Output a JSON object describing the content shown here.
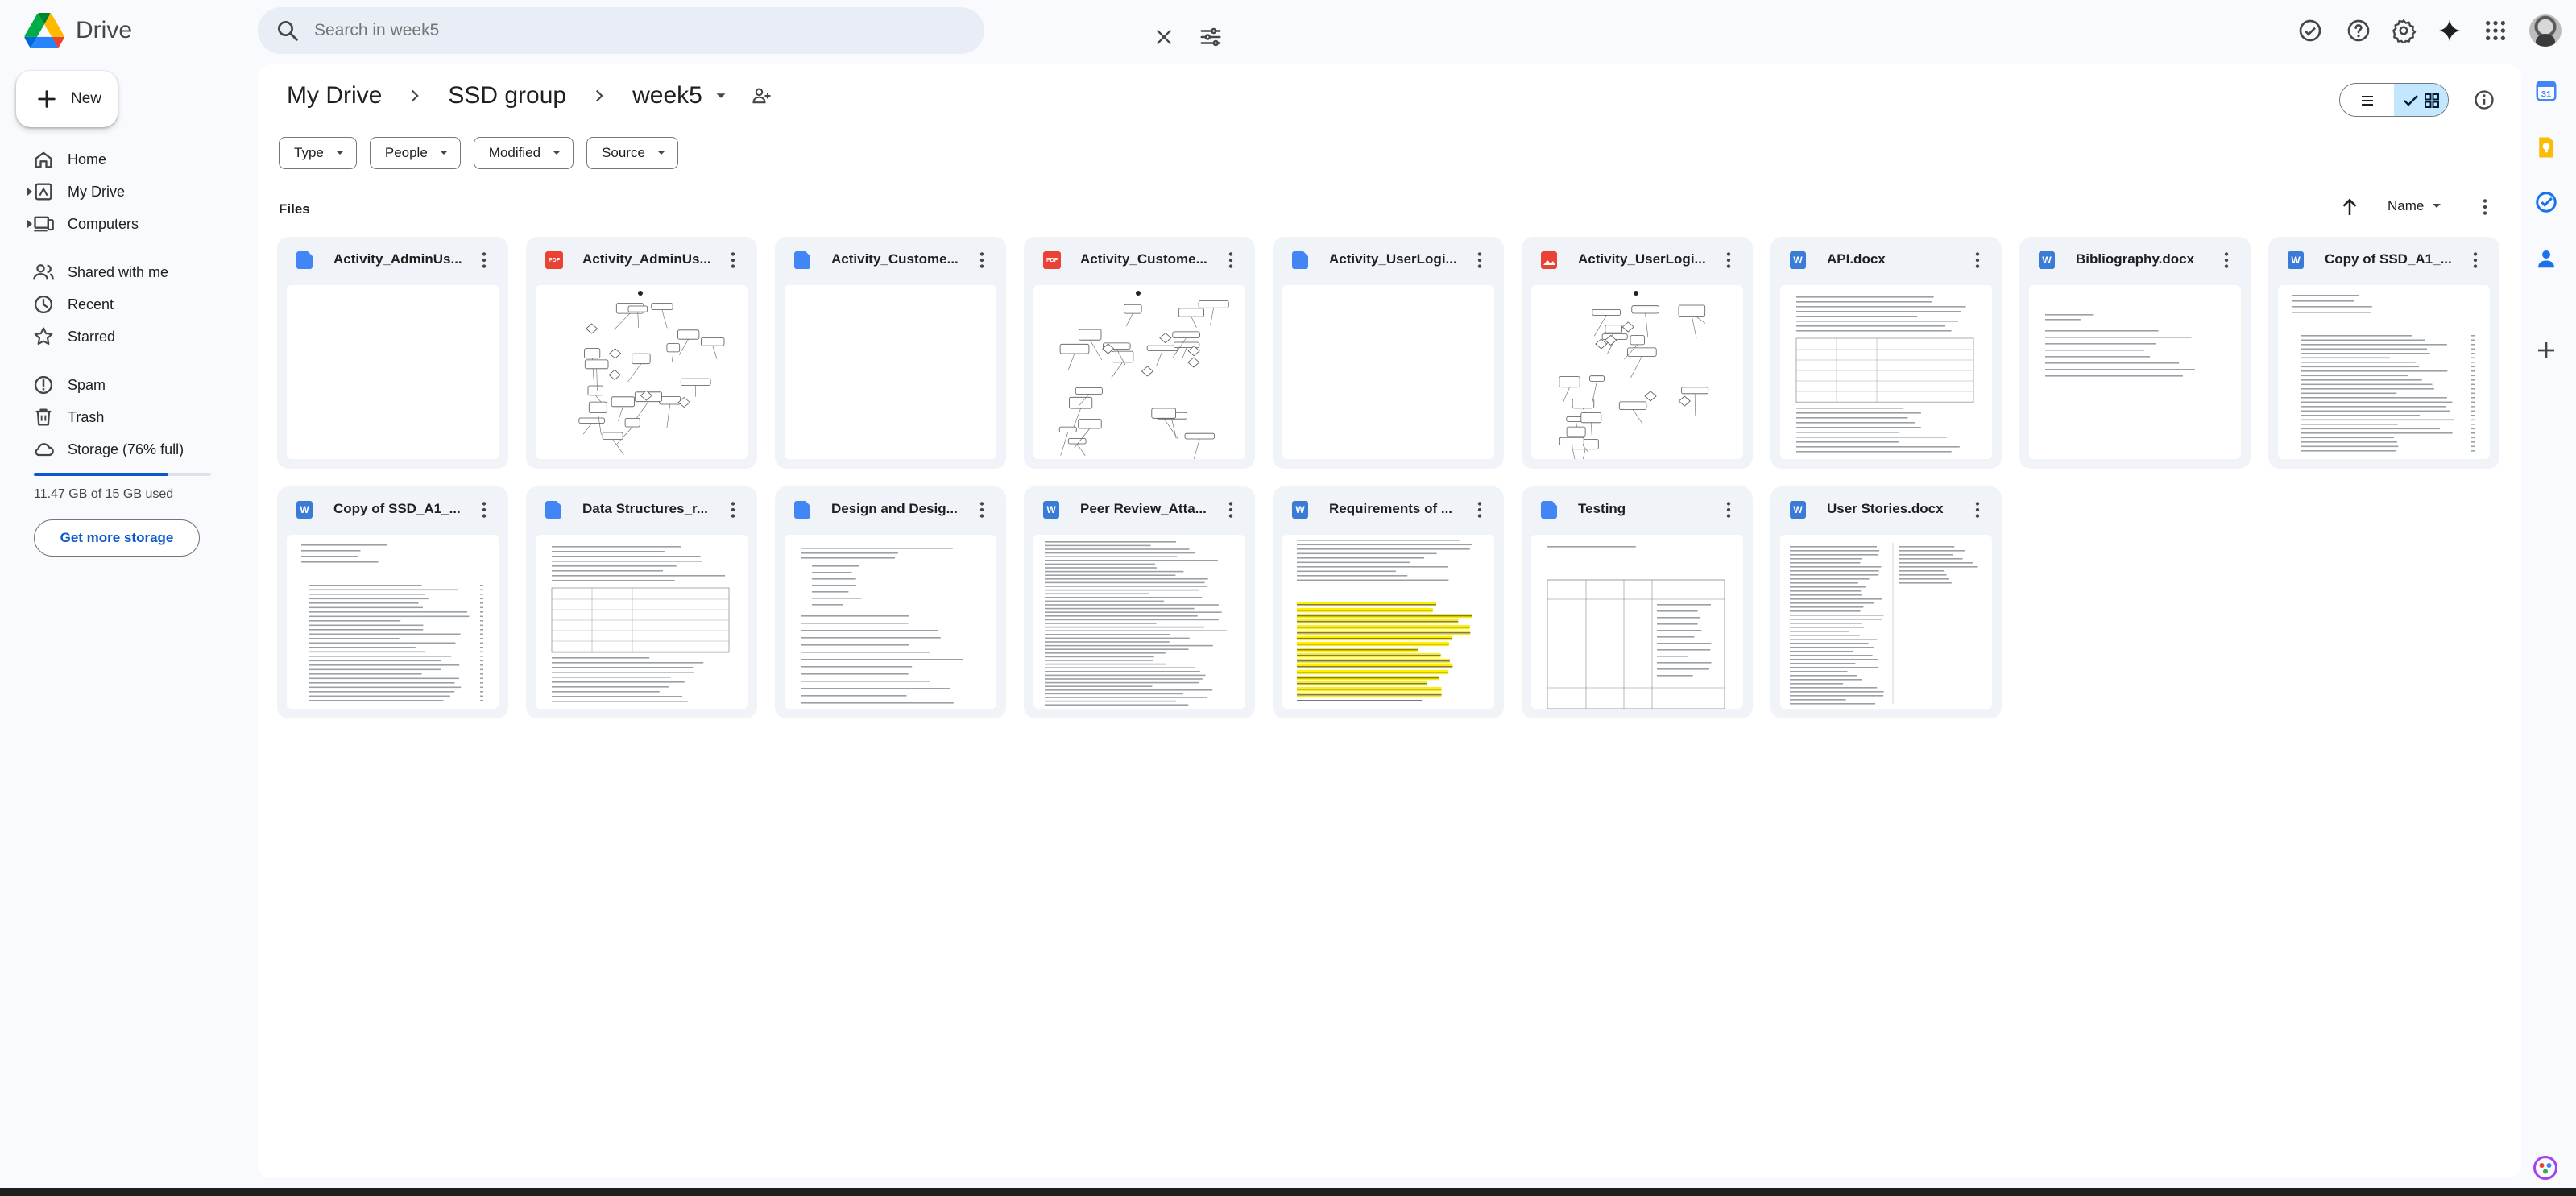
{
  "app": {
    "name": "Drive"
  },
  "search": {
    "placeholder": "Search in week5",
    "value": ""
  },
  "header_icons": [
    "offline-status-icon",
    "help-icon",
    "settings-icon",
    "gemini-icon",
    "apps-icon",
    "account-avatar"
  ],
  "sidebar": {
    "new_label": "New",
    "items": [
      {
        "label": "Home",
        "icon": "home-icon"
      },
      {
        "label": "My Drive",
        "icon": "my-drive-icon"
      },
      {
        "label": "Computers",
        "icon": "computers-icon"
      },
      {
        "label": "Shared with me",
        "icon": "shared-icon"
      },
      {
        "label": "Recent",
        "icon": "recent-icon"
      },
      {
        "label": "Starred",
        "icon": "star-icon"
      },
      {
        "label": "Spam",
        "icon": "spam-icon"
      },
      {
        "label": "Trash",
        "icon": "trash-icon"
      },
      {
        "label": "Storage (76% full)",
        "icon": "cloud-icon"
      }
    ],
    "storage_used_fraction": 0.76,
    "storage_text": "11.47 GB of 15 GB used",
    "get_more_storage": "Get more storage"
  },
  "breadcrumb": [
    "My Drive",
    "SSD group",
    "week5"
  ],
  "filters": [
    "Type",
    "People",
    "Modified",
    "Source"
  ],
  "section": {
    "title": "Files",
    "sort_label": "Name"
  },
  "files": [
    {
      "name": "Activity_AdminUs...",
      "type": "docs",
      "preview": "blank"
    },
    {
      "name": "Activity_AdminUs...",
      "type": "pdf",
      "preview": "flowchart"
    },
    {
      "name": "Activity_Custome...",
      "type": "docs",
      "preview": "blank"
    },
    {
      "name": "Activity_Custome...",
      "type": "pdf",
      "preview": "flowchart"
    },
    {
      "name": "Activity_UserLogi...",
      "type": "docs",
      "preview": "blank"
    },
    {
      "name": "Activity_UserLogi...",
      "type": "image",
      "preview": "flowchart"
    },
    {
      "name": "API.docx",
      "type": "word",
      "preview": "doc-table"
    },
    {
      "name": "Bibliography.docx",
      "type": "word",
      "preview": "doc-sparse"
    },
    {
      "name": "Copy of SSD_A1_...",
      "type": "word",
      "preview": "doc-toc"
    },
    {
      "name": "Copy of SSD_A1_...",
      "type": "word",
      "preview": "doc-toc"
    },
    {
      "name": "Data Structures_r...",
      "type": "docs",
      "preview": "doc-table"
    },
    {
      "name": "Design and Desig...",
      "type": "docs",
      "preview": "doc-list"
    },
    {
      "name": "Peer Review_Atta...",
      "type": "word",
      "preview": "doc-dense"
    },
    {
      "name": "Requirements of ...",
      "type": "word",
      "preview": "doc-highlight"
    },
    {
      "name": "Testing",
      "type": "docs",
      "preview": "doc-grid"
    },
    {
      "name": "User Stories.docx",
      "type": "word",
      "preview": "doc-columns"
    }
  ],
  "type_badges": {
    "docs": "",
    "word": "W",
    "pdf": "PDF",
    "image": ""
  },
  "colors": {
    "accent": "#0b57d0",
    "selected": "#c2e7ff",
    "docs": "#4285f4",
    "pdf": "#ea4335",
    "highlight": "#ffef00"
  }
}
